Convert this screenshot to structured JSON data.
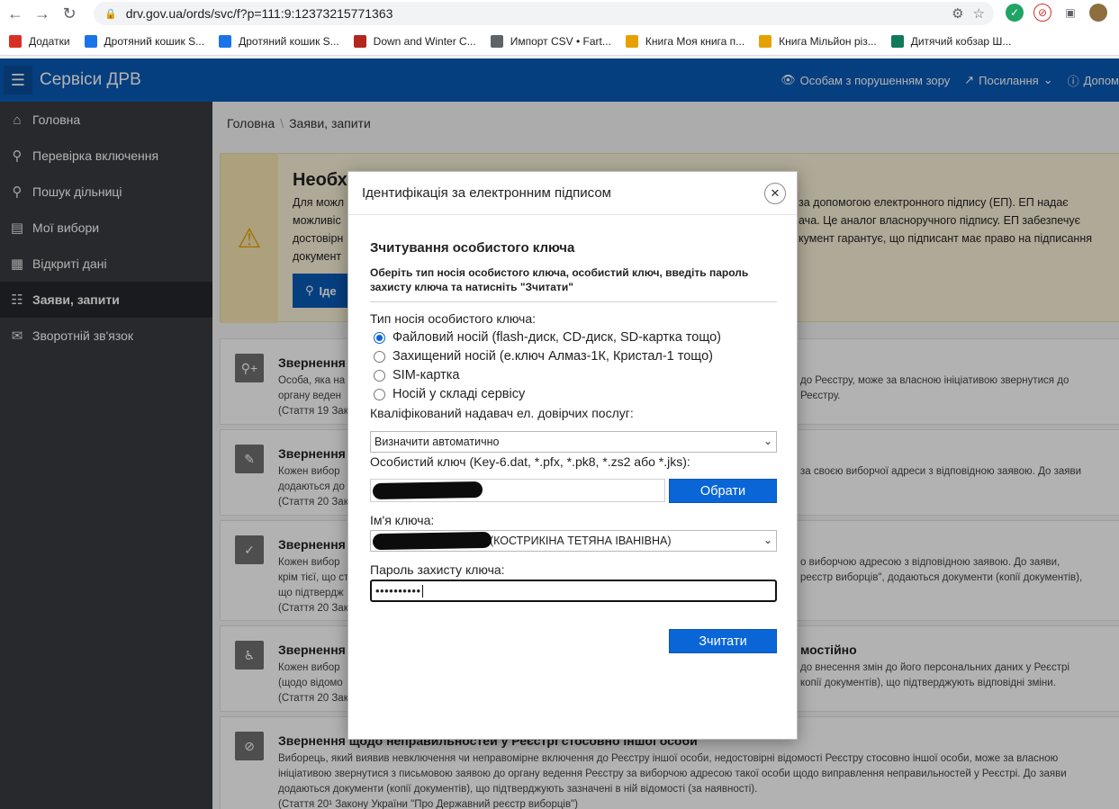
{
  "browser": {
    "url": "drv.gov.ua/ords/svc/f?p=111:9:12373215771363",
    "bookmarks": [
      {
        "label": "Додатки",
        "color": "#d93025"
      },
      {
        "label": "Дротяний кошик S...",
        "color": "#1a73e8"
      },
      {
        "label": "Дротяний кошик S...",
        "color": "#1a73e8"
      },
      {
        "label": "Down and Winter C...",
        "color": "#b3261e"
      },
      {
        "label": "Импорт CSV • Fart...",
        "color": "#5f6368"
      },
      {
        "label": "Книга Моя книга п...",
        "color": "#e6a100"
      },
      {
        "label": "Книга Мільйон різ...",
        "color": "#e6a100"
      },
      {
        "label": "Дитячий кобзар Ш...",
        "color": "#0f7a5a"
      }
    ]
  },
  "header": {
    "title": "Сервіси ДРВ",
    "links": {
      "vision": "Особам з порушенням зору",
      "links": "Посилання",
      "help": "Допом"
    }
  },
  "sidebar": {
    "items": [
      {
        "label": "Головна",
        "icon": "home-icon"
      },
      {
        "label": "Перевірка включення",
        "icon": "user-search-icon"
      },
      {
        "label": "Пошук дільниці",
        "icon": "search-icon"
      },
      {
        "label": "Мої вибори",
        "icon": "ballot-icon"
      },
      {
        "label": "Відкриті дані",
        "icon": "data-icon"
      },
      {
        "label": "Заяви, запити",
        "icon": "documents-icon"
      },
      {
        "label": "Зворотній зв'язок",
        "icon": "feedback-icon"
      }
    ]
  },
  "breadcrumb": {
    "home": "Головна",
    "current": "Заяви, запити"
  },
  "alert": {
    "title": "Необх",
    "line1_left": "Для можл",
    "line1_right": "за допомогою електронного підпису (ЕП). ЕП надає",
    "line2_left": "можливіс",
    "line2_right": "ача. Це аналог власноручного підпису. ЕП забезпечує",
    "line3_left": "достовірн",
    "line3_right": "кумент гарантує, що підписант має право на підписання",
    "line4_left": "документ",
    "button": "Іде"
  },
  "cards": [
    {
      "title": "Звернення щ",
      "lines": [
        "Особа, яка на",
        "органу веден",
        "(Стаття 19 Зак"
      ],
      "right_lines": [
        "до Реєстру, може за власною ініціативою звернутися до",
        "Реєстру."
      ]
    },
    {
      "title": "Звернення щ",
      "lines": [
        "Кожен вибор",
        "додаються до",
        "(Стаття 20 Зак"
      ],
      "right_lines": [
        "за своєю виборчої адреси з відповідною заявою. До заяви",
        ""
      ]
    },
    {
      "title": "Звернення щ",
      "lines": [
        "Кожен вибор",
        "крім тієї, що ст",
        "що підтвердж",
        "(Стаття 20 Зак"
      ],
      "right_lines": [
        "о виборчою адресою з відповідною заявою. До заяви,",
        "реєстр виборців\", додаються документи (копії документів),"
      ]
    },
    {
      "title": "Звернення щ",
      "title_right": "мостійно",
      "lines": [
        "Кожен вибор",
        "(щодо відомо",
        "(Стаття 20 Зак"
      ],
      "right_lines": [
        "до внесення змін до його персональних даних у Реєстрі",
        "копії документів), що підтверджують відповідні зміни."
      ]
    },
    {
      "title": "Звернення щодо неправильностей у Реєстрі стосовно іншої особи",
      "full_lines": [
        "Виборець, який виявив невключення чи неправомірне включення до Реєстру іншої особи, недостовірні відомості Реєстру стосовно іншої особи, може за власною",
        "ініціативою звернутися з письмовою заявою до органу ведення Реєстру за виборчою адресою такої особи щодо виправлення неправильностей у Реєстрі. До заяви",
        "додаються документи (копії документів), що підтверджують зазначені в ній відомості (за наявності).",
        "(Стаття 20¹ Закону України \"Про Державний реєстр виборців\")"
      ]
    }
  ],
  "dialog": {
    "title": "Ідентифікація за електронним підписом",
    "section_title": "Зчитування особистого ключа",
    "section_subtitle": "Оберіть тип носія особистого ключа, особистий ключ, введіть пароль захисту ключа та натисніть \"Зчитати\"",
    "media_label": "Тип носія особистого ключа:",
    "media_options": [
      {
        "label": "Файловий носій (flash-диск, CD-диск, SD-картка тощо)",
        "selected": true
      },
      {
        "label": "Захищений носій (е.ключ Алмаз-1К, Кристал-1 тощо)",
        "selected": false
      },
      {
        "label": "SIM-картка",
        "selected": false
      },
      {
        "label": "Носій у складі сервісу",
        "selected": false
      }
    ],
    "provider_label": "Кваліфікований надавач ел. довірчих послуг:",
    "provider_value": "Визначити автоматично",
    "key_label": "Особистий ключ (Key-6.dat, *.pfx, *.pk8, *.zs2 або *.jks):",
    "choose_button": "Обрати",
    "key_name_label": "Ім'я ключа:",
    "key_name_value": "(КОСТРИКІНА ТЕТЯНА ІВАНІВНА)",
    "password_label": "Пароль захисту ключа:",
    "password_value": "••••••••••",
    "read_button": "Зчитати"
  }
}
